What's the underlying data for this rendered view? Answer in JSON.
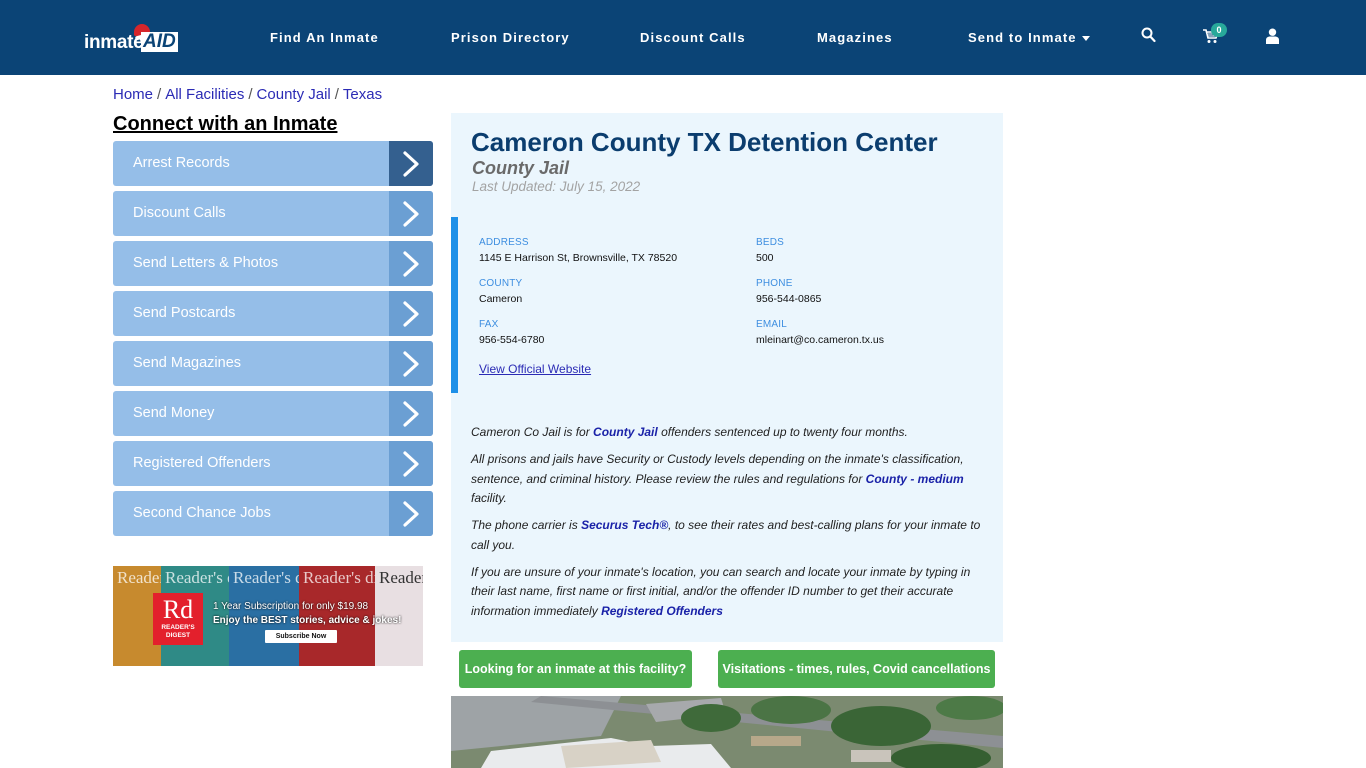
{
  "nav": {
    "logo_text_1": "inmate",
    "logo_text_2": "AID",
    "links": [
      "Find An Inmate",
      "Prison Directory",
      "Discount Calls",
      "Magazines",
      "Send to Inmate"
    ],
    "cart_count": "0",
    "icons": [
      "search-icon",
      "cart-icon",
      "user-icon"
    ]
  },
  "breadcrumb": [
    "Home",
    "All Facilities",
    "County Jail",
    "Texas"
  ],
  "sidebar": {
    "title": "Connect with an Inmate",
    "items": [
      {
        "label": "Arrest Records"
      },
      {
        "label": "Discount Calls"
      },
      {
        "label": "Send Letters & Photos"
      },
      {
        "label": "Send Postcards"
      },
      {
        "label": "Send Magazines"
      },
      {
        "label": "Send Money"
      },
      {
        "label": "Registered Offenders"
      },
      {
        "label": "Second Chance Jobs"
      }
    ]
  },
  "ad": {
    "masthead": "Reader's digest",
    "logo_big": "Rd",
    "logo_small_1": "READER'S",
    "logo_small_2": "DIGEST",
    "line1": "1 Year Subscription for only $19.98",
    "line2": "Enjoy the BEST stories, advice & jokes!",
    "button": "Subscribe Now"
  },
  "facility": {
    "title": "Cameron County TX Detention Center",
    "type": "County Jail",
    "updated": "Last Updated: July 15, 2022",
    "fields": {
      "address": {
        "label": "ADDRESS",
        "value": "1145 E Harrison St, Brownsville, TX 78520"
      },
      "beds": {
        "label": "BEDS",
        "value": "500"
      },
      "county": {
        "label": "COUNTY",
        "value": "Cameron"
      },
      "phone": {
        "label": "PHONE",
        "value": "956-544-0865"
      },
      "fax": {
        "label": "FAX",
        "value": "956-554-6780"
      },
      "email": {
        "label": "EMAIL",
        "value": "mleinart@co.cameron.tx.us"
      }
    },
    "website_link": "View Official Website",
    "description": {
      "p1_a": "Cameron Co Jail is for ",
      "p1_link": "County Jail",
      "p1_b": " offenders sentenced up to twenty four months.",
      "p2_a": "All prisons and jails have Security or Custody levels depending on the inmate's classification, sentence, and criminal history. Please review the rules and regulations for ",
      "p2_link": "County - medium",
      "p2_b": " facility.",
      "p3_a": "The phone carrier is ",
      "p3_link": "Securus Tech®",
      "p3_b": ", to see their rates and best-calling plans for your inmate to call you.",
      "p4_a": "If you are unsure of your inmate's location, you can search and locate your inmate by typing in their last name, first name or first initial, and/or the offender ID number to get their accurate information immediately ",
      "p4_link": "Registered Offenders"
    }
  },
  "buttons": {
    "find_inmate": "Looking for an inmate at this facility?",
    "visitations": "Visitations - times, rules, Covid cancellations"
  }
}
